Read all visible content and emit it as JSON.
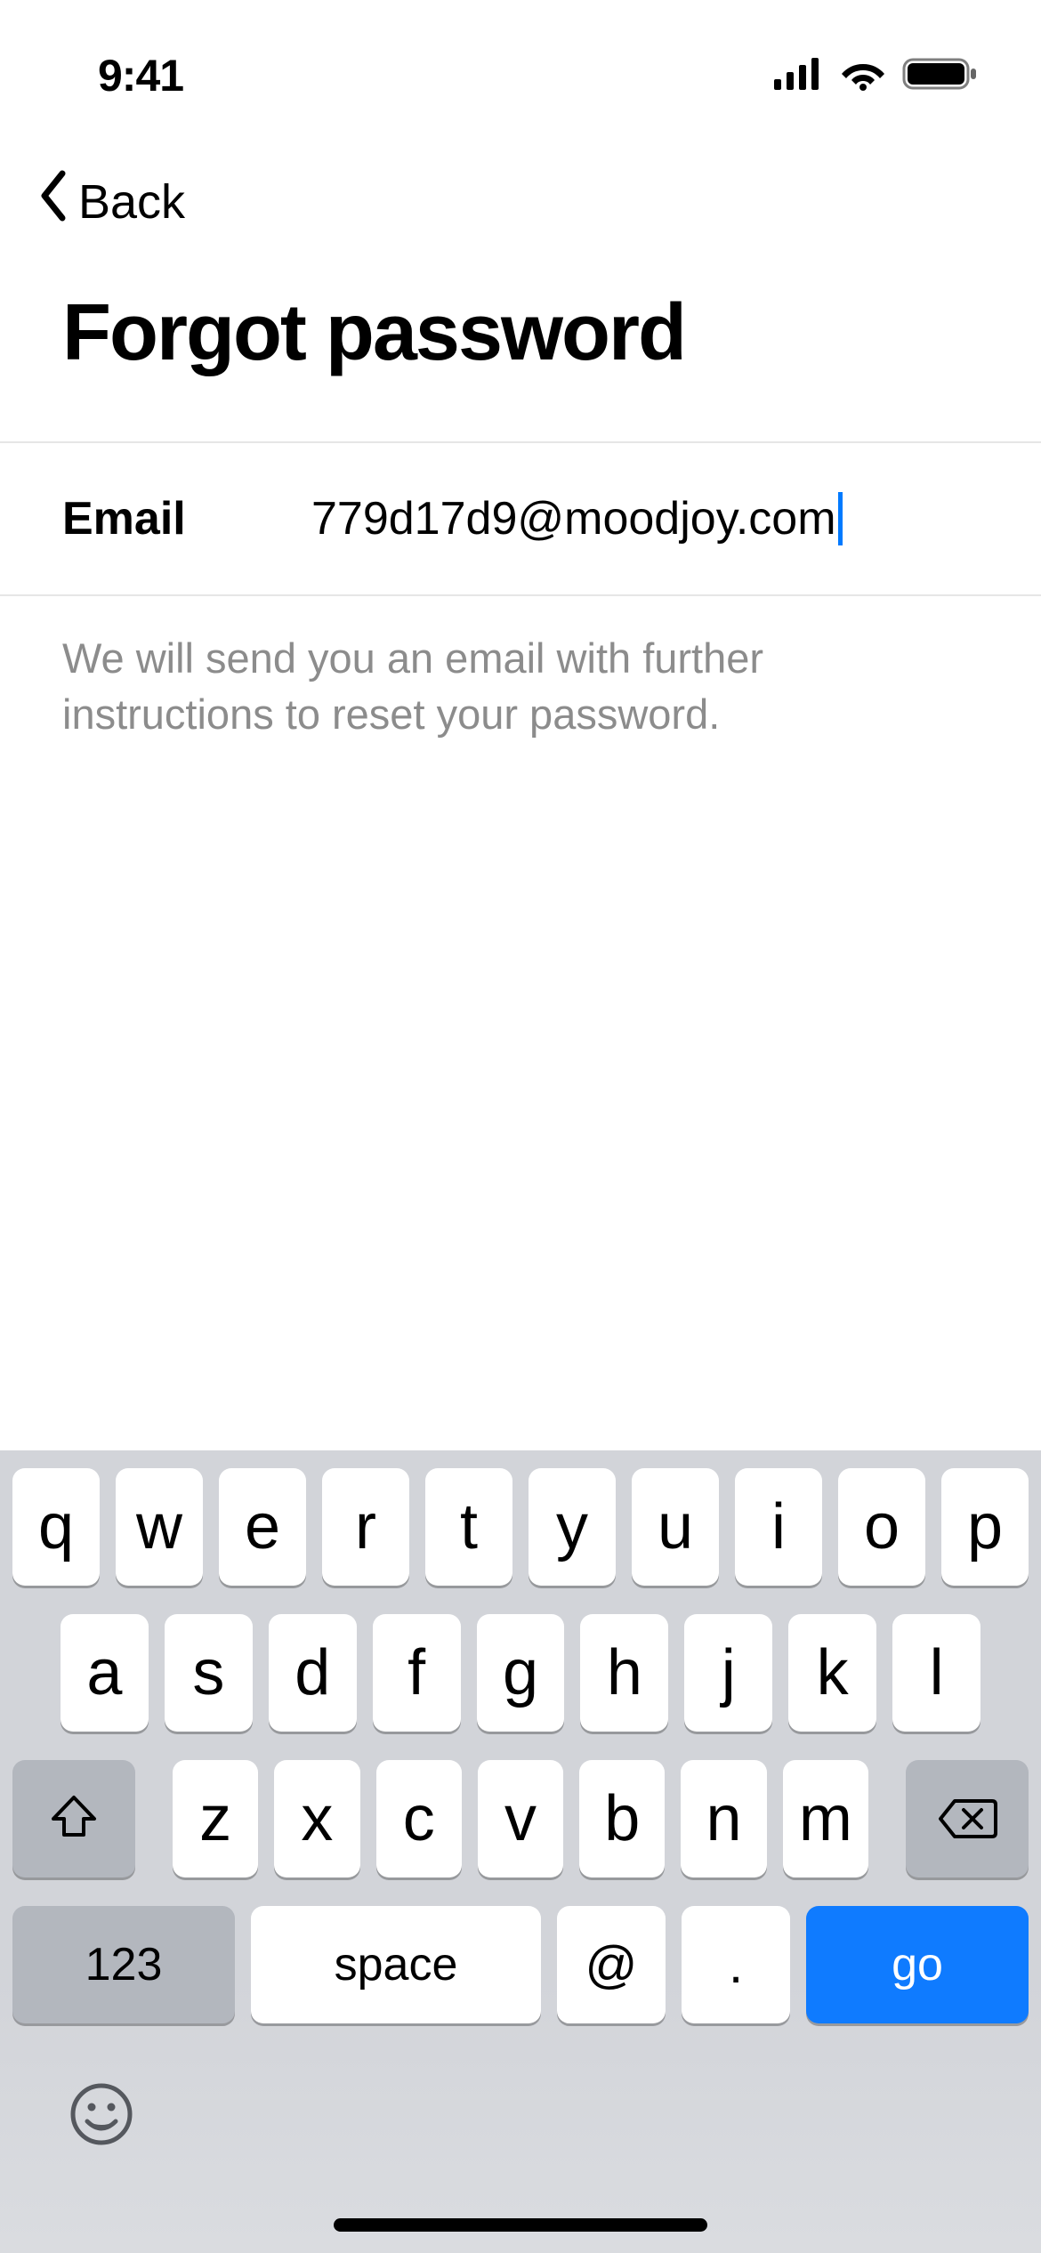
{
  "statusbar": {
    "time": "9:41"
  },
  "nav": {
    "back_label": "Back"
  },
  "page": {
    "title": "Forgot password"
  },
  "form": {
    "email_label": "Email",
    "email_value": "779d17d9@moodjoy.com",
    "helper_text": "We will send you an email with further instructions to reset your password."
  },
  "keyboard": {
    "row1": [
      "q",
      "w",
      "e",
      "r",
      "t",
      "y",
      "u",
      "i",
      "o",
      "p"
    ],
    "row2": [
      "a",
      "s",
      "d",
      "f",
      "g",
      "h",
      "j",
      "k",
      "l"
    ],
    "row3": [
      "z",
      "x",
      "c",
      "v",
      "b",
      "n",
      "m"
    ],
    "numbers_label": "123",
    "space_label": "space",
    "at_label": "@",
    "dot_label": ".",
    "go_label": "go"
  }
}
